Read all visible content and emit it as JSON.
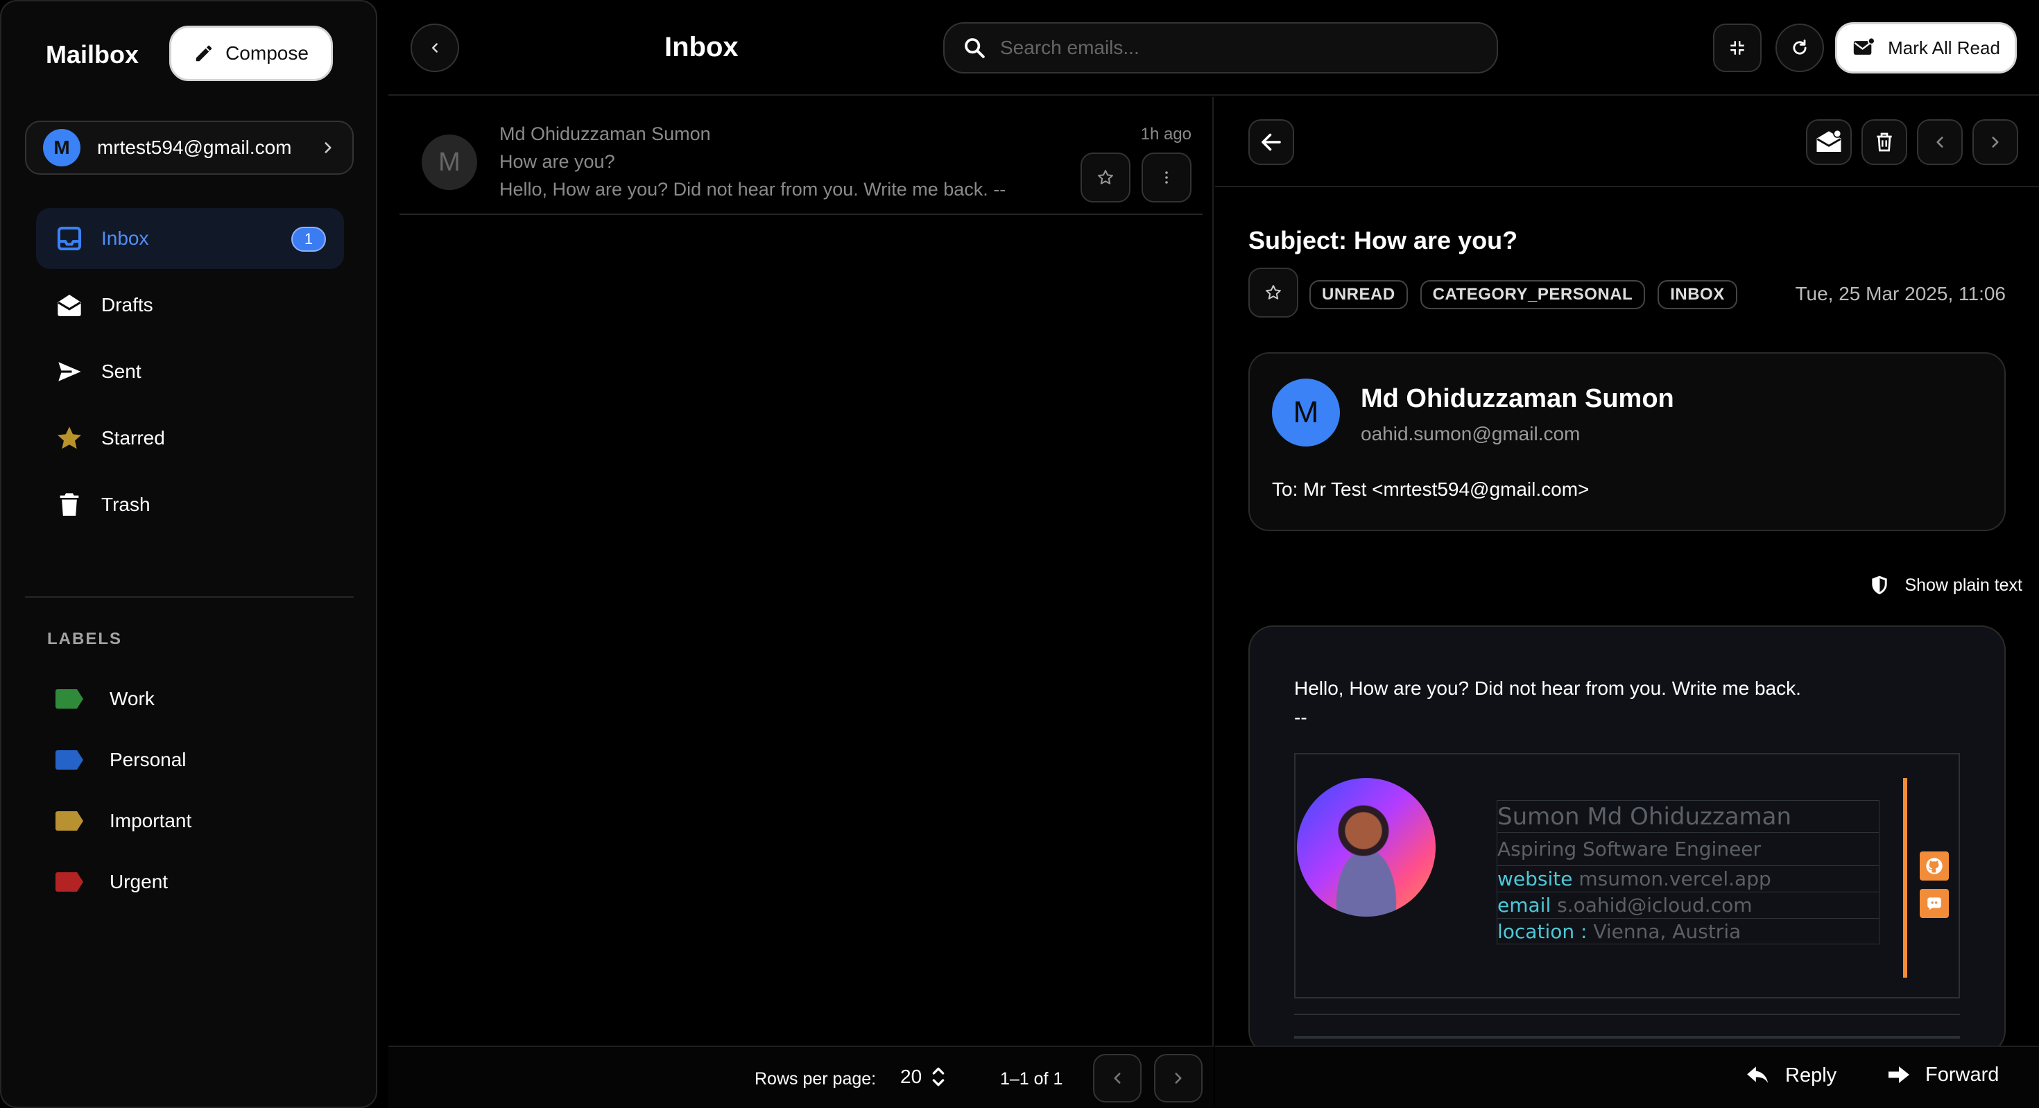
{
  "sidebar": {
    "brand": "Mailbox",
    "compose_label": "Compose",
    "account": {
      "initial": "M",
      "email": "mrtest594@gmail.com"
    },
    "nav": [
      {
        "label": "Inbox",
        "icon": "inbox-icon",
        "badge": "1",
        "active": true
      },
      {
        "label": "Drafts",
        "icon": "drafts-icon"
      },
      {
        "label": "Sent",
        "icon": "send-icon"
      },
      {
        "label": "Starred",
        "icon": "star-icon"
      },
      {
        "label": "Trash",
        "icon": "trash-icon"
      }
    ],
    "labels_title": "LABELS",
    "labels": [
      {
        "label": "Work",
        "color": "#2f8a3a"
      },
      {
        "label": "Personal",
        "color": "#2563c9"
      },
      {
        "label": "Important",
        "color": "#b89230"
      },
      {
        "label": "Urgent",
        "color": "#b42323"
      }
    ]
  },
  "topbar": {
    "title": "Inbox",
    "search_placeholder": "Search emails...",
    "mark_all_label": "Mark All Read"
  },
  "list": {
    "emails": [
      {
        "initial": "M",
        "sender": "Md Ohiduzzaman Sumon",
        "subject": "How are you?",
        "preview": "Hello, How are you? Did not hear from you. Write me back. --",
        "time": "1h ago"
      }
    ],
    "footer": {
      "rows_label": "Rows per page:",
      "rows_value": "20",
      "range": "1–1 of 1"
    }
  },
  "reader": {
    "subject": "Subject: How are you?",
    "chips": [
      "UNREAD",
      "CATEGORY_PERSONAL",
      "INBOX"
    ],
    "date": "Tue, 25 Mar 2025, 11:06",
    "sender": {
      "initial": "M",
      "name": "Md Ohiduzzaman Sumon",
      "email": "oahid.sumon@gmail.com",
      "to": "To: Mr Test <mrtest594@gmail.com>"
    },
    "plain_text_label": "Show plain text",
    "body": {
      "line1": "Hello, How are you? Did not hear from you. Write me back.",
      "line2": "--"
    },
    "signature": {
      "name": "Sumon Md Ohiduzzaman",
      "role": "Aspiring Software Engineer",
      "website_key": "website",
      "website_val": "msumon.vercel.app",
      "email_key": "email",
      "email_val": "s.oahid@icloud.com",
      "location_key": "location :",
      "location_val": "Vienna, Austria",
      "accent": "#f28c38"
    },
    "reply_label": "Reply",
    "forward_label": "Forward"
  }
}
